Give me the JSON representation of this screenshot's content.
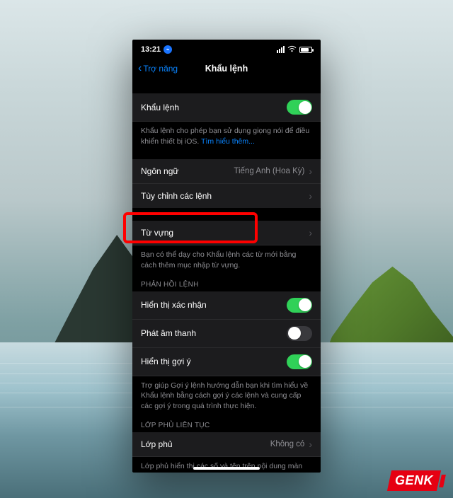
{
  "status": {
    "time": "13:21",
    "bt_glyph": "⌁"
  },
  "nav": {
    "back": "Trợ năng",
    "title": "Khẩu lệnh"
  },
  "group1": {
    "main_toggle_label": "Khẩu lệnh",
    "description": "Khẩu lệnh cho phép bạn sử dụng giọng nói để điều khiển thiết bị iOS. ",
    "learn_more": "Tìm hiểu thêm..."
  },
  "group2": {
    "language_label": "Ngôn ngữ",
    "language_value": "Tiếng Anh (Hoa Kỳ)",
    "customize_label": "Tùy chỉnh các lệnh"
  },
  "group3": {
    "vocab_label": "Từ vựng",
    "vocab_desc": "Bạn có thể dạy cho Khẩu lệnh các từ mới bằng cách thêm mục nhập từ vựng."
  },
  "feedback": {
    "header": "PHẢN HỒI LỆNH",
    "confirm_label": "Hiển thị xác nhận",
    "sound_label": "Phát âm thanh",
    "hints_label": "Hiển thị gợi ý",
    "hints_desc": "Trợ giúp Gợi ý lệnh hướng dẫn bạn khi tìm hiểu về Khẩu lệnh bằng cách gợi ý các lệnh và cung cấp các gợi ý trong quá trình thực hiện."
  },
  "overlay": {
    "header": "LỚP PHỦ LIÊN TỤC",
    "label": "Lớp phủ",
    "value": "Không có",
    "desc": "Lớp phủ hiển thị các số và tên trên nội dung màn hình của bạn để tăng tốc độ tương tác."
  },
  "brand": "GENK"
}
